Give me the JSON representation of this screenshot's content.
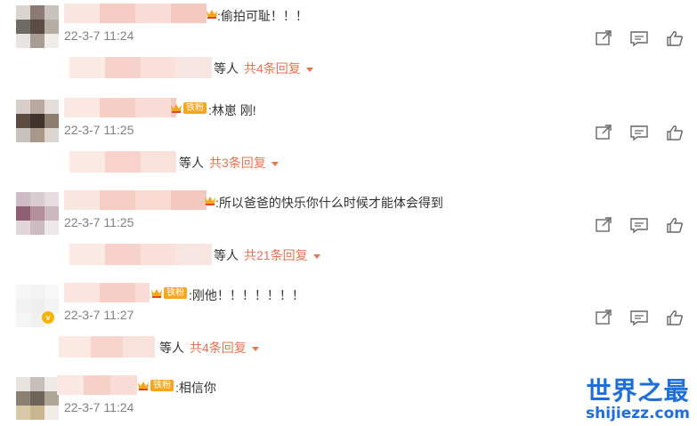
{
  "comments": [
    {
      "text": ":偷拍可耻！！！",
      "time": "22-3-7 11:24",
      "replies_who": "等人",
      "replies_count": "共4条回复"
    },
    {
      "fan_label": "铁粉",
      "text": ":林崽 刚!",
      "time": "22-3-7 11:25",
      "replies_who": "等人",
      "replies_count": "共3条回复"
    },
    {
      "text": ":所以爸爸的快乐你什么时候才能体会得到",
      "time": "22-3-7 11:25",
      "replies_who": "等人",
      "replies_count": "共21条回复"
    },
    {
      "fan_label": "铁粉",
      "text": ":刚他！！！！！！！",
      "time": "22-3-7 11:27",
      "replies_who": "等人",
      "replies_count": "共4条回复"
    },
    {
      "fan_label": "铁粉",
      "text": ":相信你",
      "time": "22-3-7 11:24"
    }
  ],
  "watermark": {
    "title": "世界之最",
    "subtitle": "shijiezz.com"
  },
  "colors": {
    "accent": "#eb7350",
    "timestamp": "#808080",
    "fan_badge": "#f7a71d",
    "watermark": "#1e6fd9"
  },
  "icons": [
    "share-icon",
    "comment-icon",
    "like-icon",
    "crown-icon",
    "verified-v-icon"
  ]
}
